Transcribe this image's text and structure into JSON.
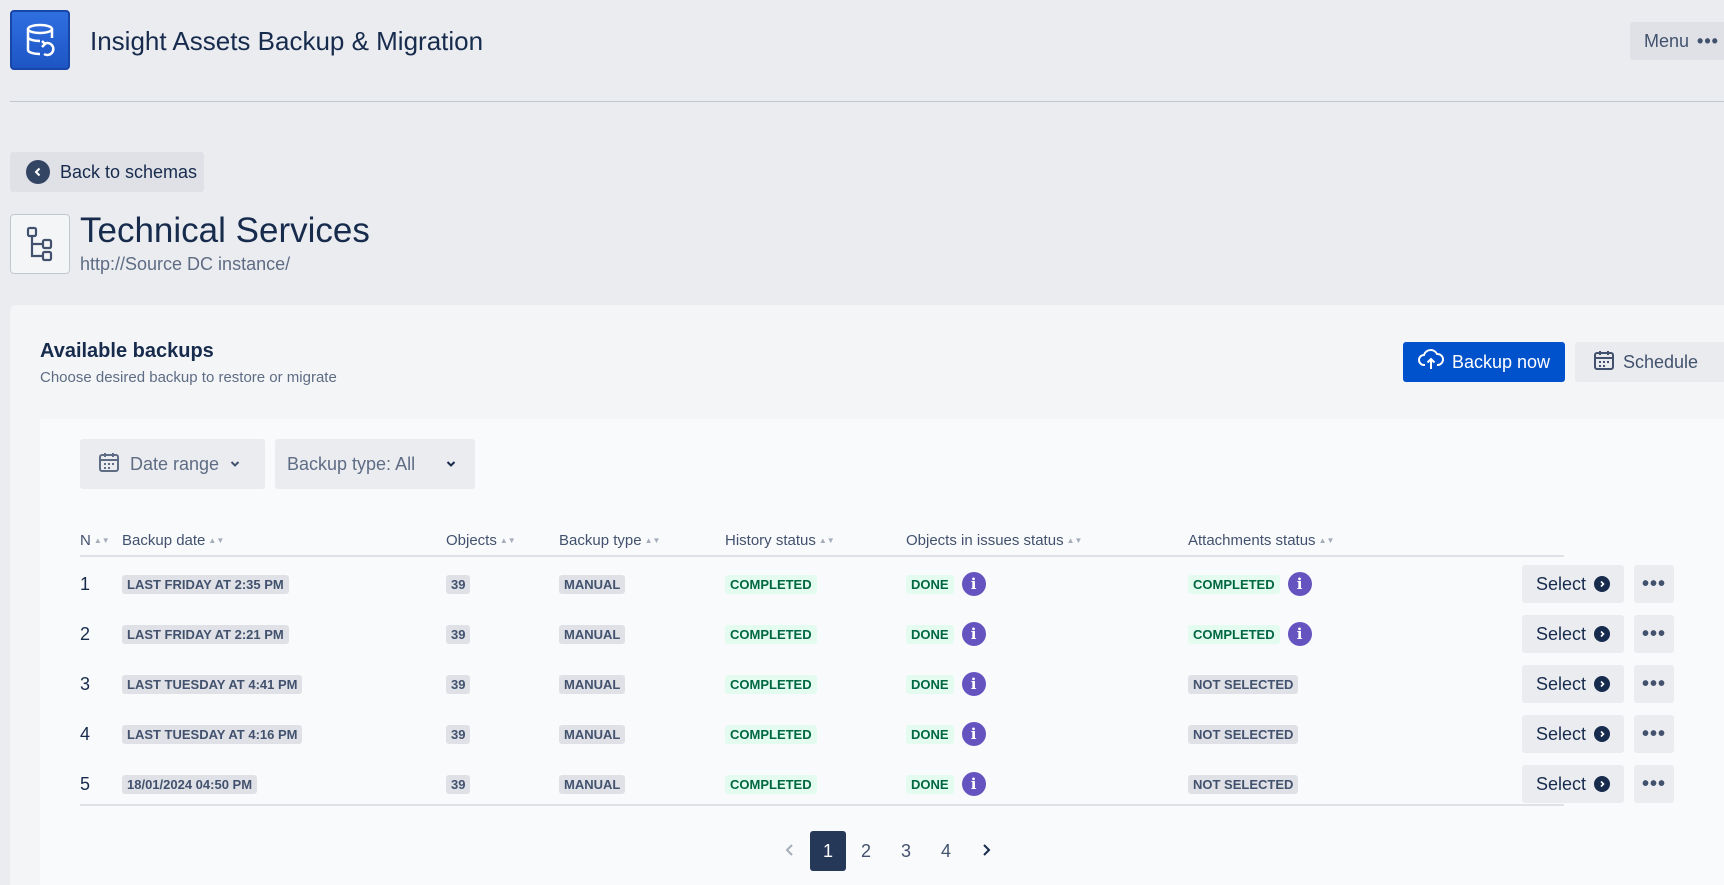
{
  "header": {
    "app_title": "Insight Assets Backup & Migration",
    "logo_icon": "database-restore-icon",
    "menu_label": "Menu"
  },
  "nav": {
    "back_label": "Back to schemas"
  },
  "schema": {
    "title": "Technical Services",
    "url": "http://Source DC instance/"
  },
  "backups": {
    "title": "Available backups",
    "subtitle": "Choose desired backup to restore or migrate",
    "backup_now_label": "Backup now",
    "schedule_label": "Schedule",
    "filters": {
      "date_range_label": "Date range",
      "backup_type_label": "Backup type: All"
    },
    "columns": [
      "N",
      "Backup date",
      "Objects",
      "Backup type",
      "History status",
      "Objects in issues status",
      "Attachments status"
    ],
    "rows": [
      {
        "n": "1",
        "date": "LAST FRIDAY AT 2:35 PM",
        "objects": "39",
        "type": "MANUAL",
        "history": "COMPLETED",
        "issues": "DONE",
        "attachments": "COMPLETED",
        "select": "Select"
      },
      {
        "n": "2",
        "date": "LAST FRIDAY AT 2:21 PM",
        "objects": "39",
        "type": "MANUAL",
        "history": "COMPLETED",
        "issues": "DONE",
        "attachments": "COMPLETED",
        "select": "Select"
      },
      {
        "n": "3",
        "date": "LAST TUESDAY AT 4:41 PM",
        "objects": "39",
        "type": "MANUAL",
        "history": "COMPLETED",
        "issues": "DONE",
        "attachments": "NOT SELECTED",
        "select": "Select"
      },
      {
        "n": "4",
        "date": "LAST TUESDAY AT 4:16 PM",
        "objects": "39",
        "type": "MANUAL",
        "history": "COMPLETED",
        "issues": "DONE",
        "attachments": "NOT SELECTED",
        "select": "Select"
      },
      {
        "n": "5",
        "date": "18/01/2024 04:50 PM",
        "objects": "39",
        "type": "MANUAL",
        "history": "COMPLETED",
        "issues": "DONE",
        "attachments": "NOT SELECTED",
        "select": "Select"
      }
    ],
    "pagination": {
      "pages": [
        "1",
        "2",
        "3",
        "4"
      ],
      "current": "1"
    }
  },
  "colors": {
    "primary": "#0052cc",
    "success_text": "#006644",
    "success_bg": "#e3fcef",
    "info": "#6554c0",
    "neutral_bg": "#dfe1e6"
  }
}
